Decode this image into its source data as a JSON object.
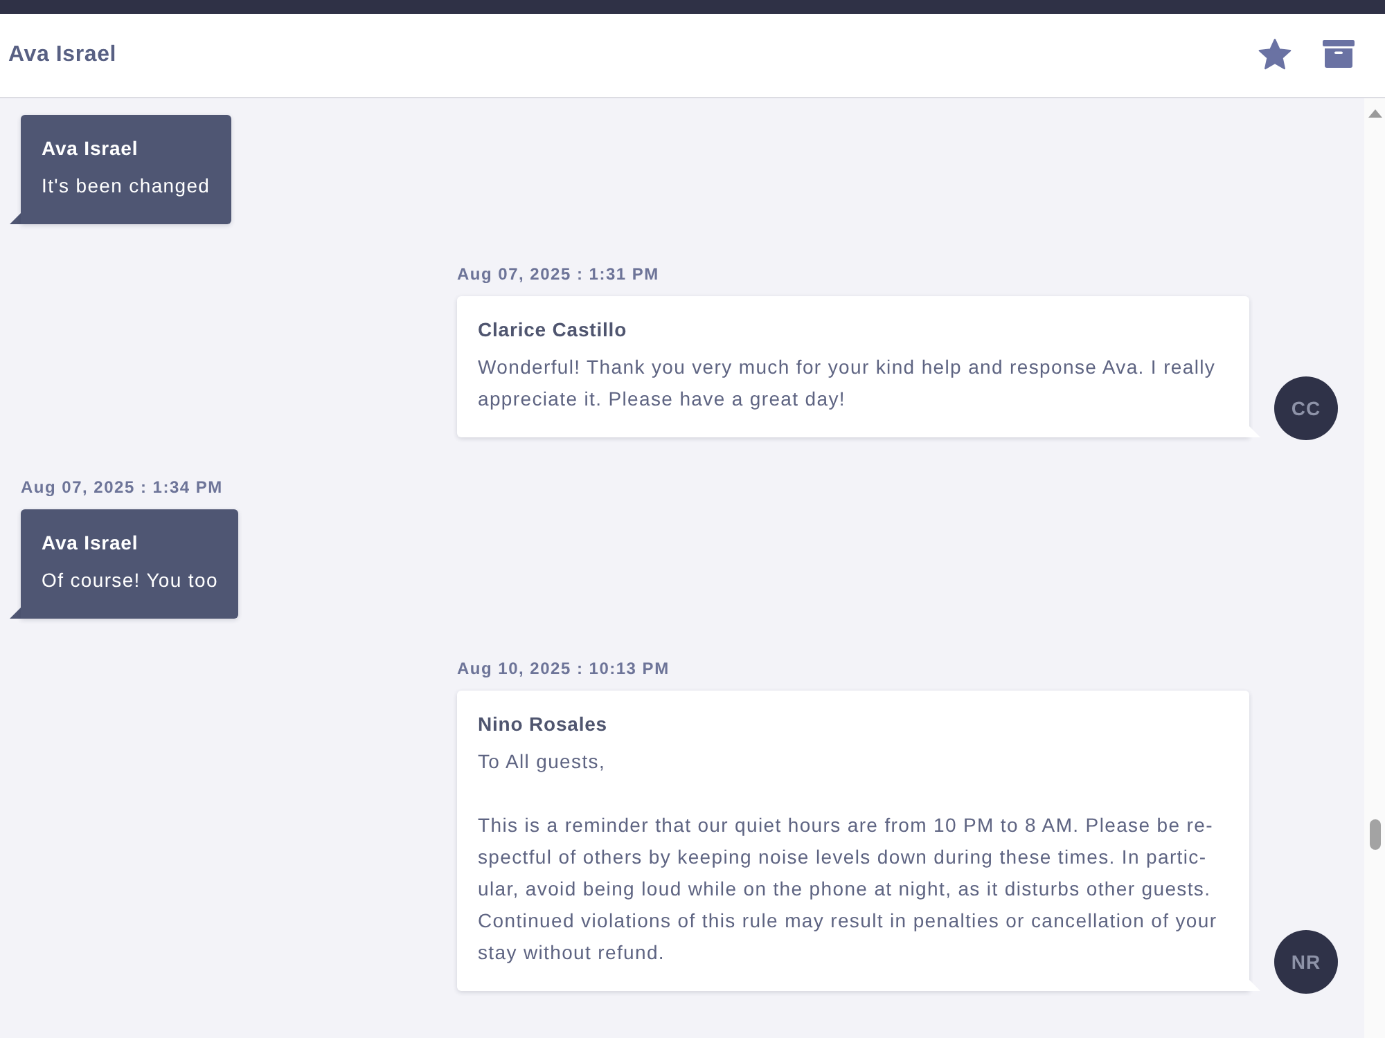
{
  "header": {
    "title": "Ava Israel"
  },
  "messages": [
    {
      "kind": "incoming",
      "sender": "Ava Israel",
      "text": "It's been changed"
    },
    {
      "kind": "outgoing",
      "timestamp": "Aug 07, 2025 : 1:31 PM",
      "sender": "Clarice Castillo",
      "text": "Wonderful! Thank you very much for your kind help and response Ava. I really appreciate it. Please have a great day!",
      "avatar": "CC"
    },
    {
      "kind": "incoming",
      "timestamp": "Aug 07, 2025 : 1:34 PM",
      "sender": "Ava Israel",
      "text": "Of course! You too"
    },
    {
      "kind": "outgoing",
      "timestamp": "Aug 10, 2025 : 10:13 PM",
      "sender": "Nino Rosales",
      "text": "To All guests,\n\nThis is a reminder that our quiet hours are from 10 PM to 8 AM. Please be re-spectful of others by keeping noise levels down during these times. In partic-ular, avoid being loud while on the phone at night, as it disturbs other guests. Continued violations of this rule may result in penalties or cancellation of your stay without refund.",
      "avatar": "NR"
    }
  ]
}
